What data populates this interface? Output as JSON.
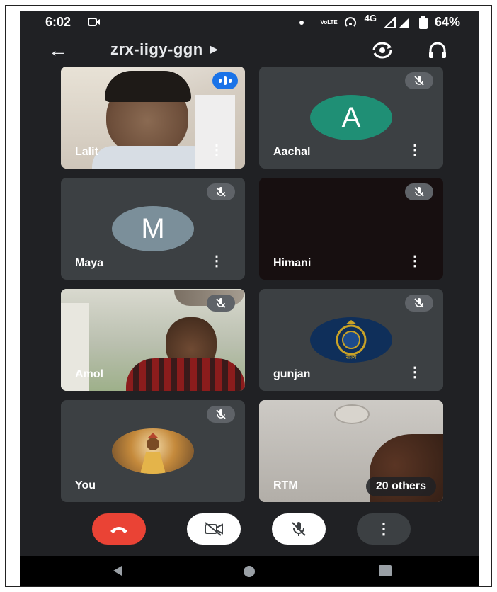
{
  "status_bar": {
    "time": "6:02",
    "indicators": [
      "video-record-icon",
      "dot-icon",
      "volte-icon",
      "hotspot-icon",
      "signal-icon",
      "battery-icon"
    ],
    "network": "4G",
    "volte": "VoLTE",
    "battery": "64%"
  },
  "top_bar": {
    "meeting_code": "zrx-iigy-ggn",
    "icons": [
      "back-arrow-icon",
      "switch-camera-icon",
      "headphones-icon"
    ]
  },
  "participants": [
    {
      "name": "Lalit",
      "speaking": true
    },
    {
      "name": "Aachal",
      "avatar_letter": "A",
      "avatar_color": "#1f8f75"
    },
    {
      "name": "Maya",
      "avatar_letter": "M",
      "avatar_color": "#7b8f9a"
    },
    {
      "name": "Himani"
    },
    {
      "name": "Amol"
    },
    {
      "name": "gunjan",
      "badge_text": "राज्य"
    },
    {
      "name": "You"
    },
    {
      "name": "RTM",
      "others_label": "20 others"
    }
  ],
  "controls": {
    "icons": [
      "end-call-icon",
      "camera-off-icon",
      "mic-off-icon",
      "more-options-icon"
    ],
    "colors": {
      "end_call": "#ea4335",
      "toggle_bg": "#ffffff",
      "more_bg": "#3c4043"
    }
  },
  "nav_bar": {
    "icons": [
      "nav-back-icon",
      "nav-home-icon",
      "nav-recents-icon"
    ]
  }
}
